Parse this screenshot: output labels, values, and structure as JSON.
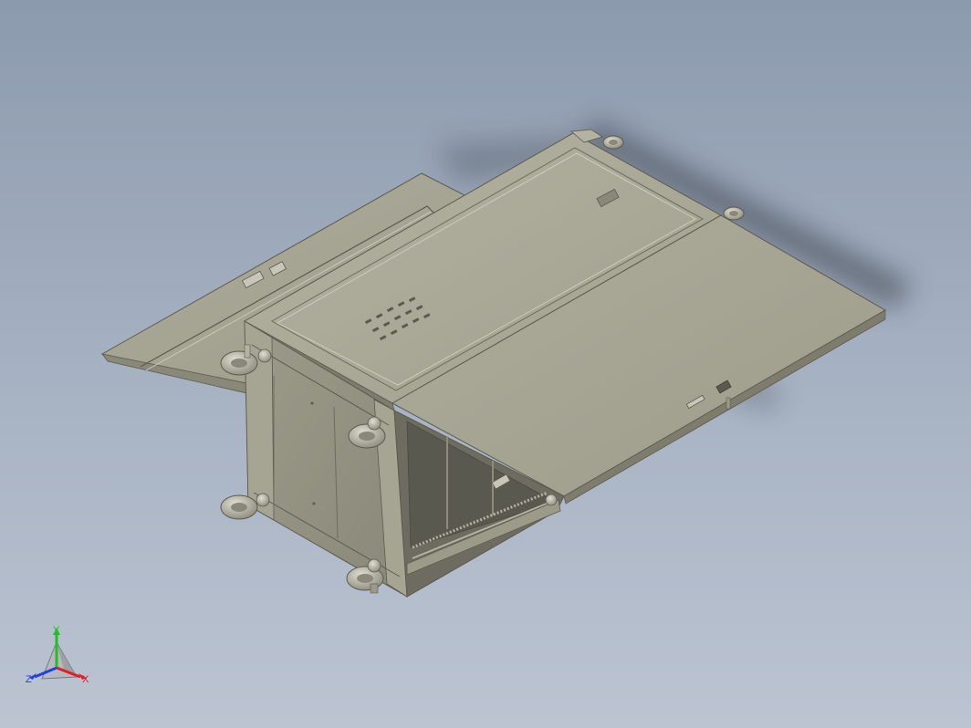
{
  "viewport": {
    "background_top": "#8c9aae",
    "background_bottom": "#bcc4d2"
  },
  "model": {
    "name": "rack-enclosure-assembly",
    "body_color": "#a8a695",
    "edge_color": "#5c5a4e",
    "shadow_color": "#3b3f4a"
  },
  "triad": {
    "x_label": "X",
    "y_label": "Y",
    "z_label": "Z",
    "x_color": "#e02020",
    "y_color": "#20c020",
    "z_color": "#2040e0"
  }
}
